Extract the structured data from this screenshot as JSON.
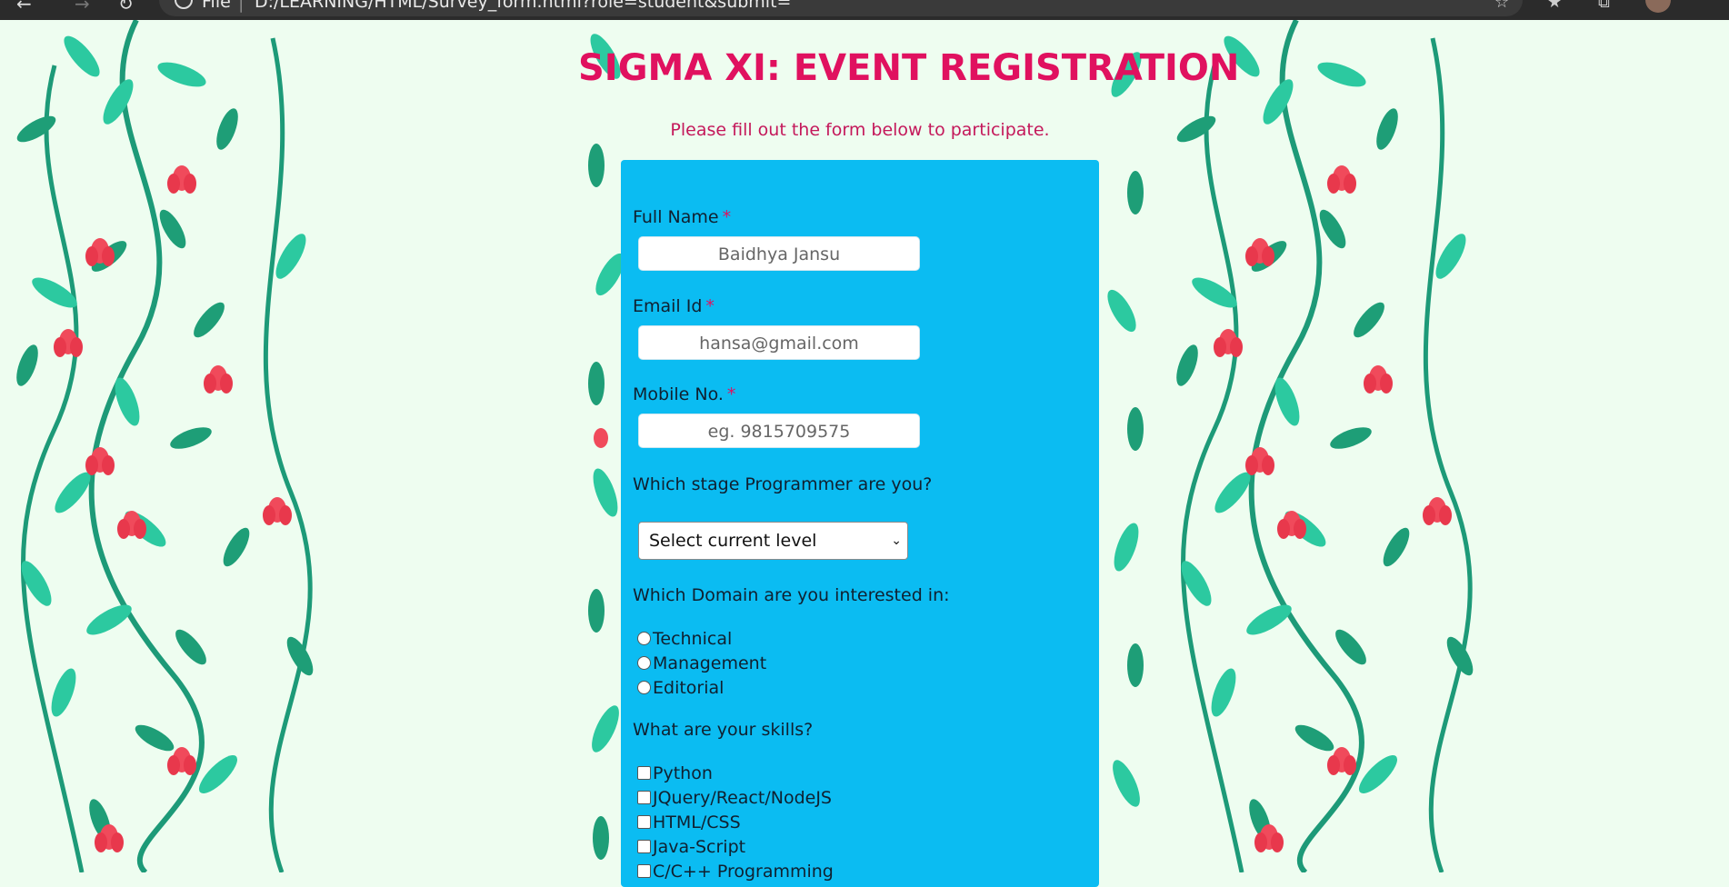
{
  "browser": {
    "file_label": "File",
    "url": "D:/LEARNING/HTML/Survey_form.html?role=student&submit="
  },
  "page": {
    "title": "SIGMA XI: EVENT REGISTRATION",
    "subtitle": "Please fill out the form below to participate."
  },
  "form": {
    "full_name": {
      "label": "Full Name",
      "required_mark": "*",
      "value": "Baidhya Jansu"
    },
    "email": {
      "label": "Email Id",
      "required_mark": "*",
      "value": "hansa@gmail.com"
    },
    "mobile": {
      "label": "Mobile No.",
      "required_mark": "*",
      "placeholder": "eg. 9815709575"
    },
    "stage": {
      "label": "Which stage Programmer are you?",
      "selected": "Select current level"
    },
    "domain": {
      "label": "Which Domain are you interested in:",
      "options": [
        "Technical",
        "Management",
        "Editorial"
      ]
    },
    "skills": {
      "label": "What are your skills?",
      "options": [
        "Python",
        "JQuery/React/NodeJS",
        "HTML/CSS",
        "Java-Script",
        "C/C++ Programming"
      ]
    }
  },
  "colors": {
    "title": "#e0115f",
    "form_background": "#0bbcf2",
    "page_background": "#eefdf0"
  }
}
